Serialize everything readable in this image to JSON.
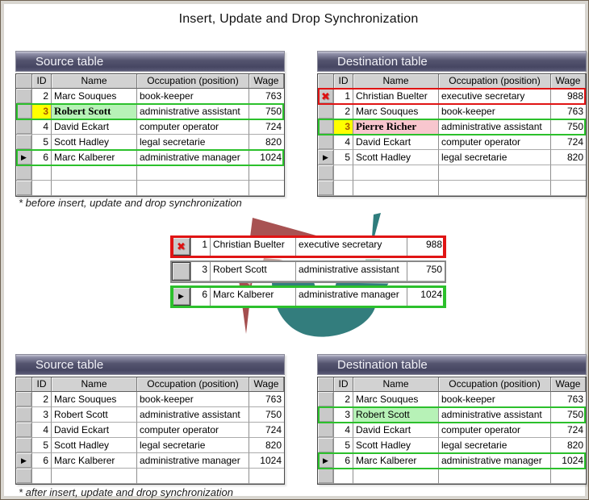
{
  "page": {
    "title": "Insert, Update and Drop Synchronization",
    "caption_before": "* before insert, update and drop synchronization",
    "caption_after": "* after insert, update and drop synchronization"
  },
  "columns": {
    "id": "ID",
    "name": "Name",
    "occupation": "Occupation (position)",
    "wage": "Wage"
  },
  "icons": {
    "arrow": "▶",
    "delete": "✖"
  },
  "colors": {
    "green-border": "#2cc02c",
    "red-border": "#e01414",
    "yellow-cell": "#ffff00",
    "yellow-text": "#a85400",
    "green-cell": "#b7f2b7",
    "pink-cell": "#f8c6ce",
    "delete-x": "#dd1111",
    "titlebar-dark": "#464662",
    "logo-teal": "#337d7d",
    "logo-teal-light": "#92c0b8",
    "logo-red": "#a85252"
  },
  "tables": [
    {
      "id": "source-before",
      "title": "Source table",
      "empty_rows": 2,
      "rows": [
        {
          "id": "2",
          "name": "Marc Souques",
          "occupation": "book-keeper",
          "wage": "763"
        },
        {
          "id": "3",
          "name": "Robert Scott",
          "occupation": "administrative assistant",
          "wage": "750",
          "highlight": "green",
          "id_bg": "yellow",
          "name_bg": "green",
          "bold_name": true
        },
        {
          "id": "4",
          "name": "David Eckart",
          "occupation": "computer operator",
          "wage": "724"
        },
        {
          "id": "5",
          "name": "Scott Hadley",
          "occupation": "legal secretarie",
          "wage": "820"
        },
        {
          "id": "6",
          "name": "Marc Kalberer",
          "occupation": "administrative manager",
          "wage": "1024",
          "highlight": "green",
          "selector": "arrow"
        }
      ]
    },
    {
      "id": "destination-before",
      "title": "Destination table",
      "empty_rows": 2,
      "rows": [
        {
          "id": "1",
          "name": "Christian Buelter",
          "occupation": "executive secretary",
          "wage": "988",
          "highlight": "red",
          "selector": "delete"
        },
        {
          "id": "2",
          "name": "Marc Souques",
          "occupation": "book-keeper",
          "wage": "763"
        },
        {
          "id": "3",
          "name": "Pierre Richer",
          "occupation": "administrative assistant",
          "wage": "750",
          "highlight": "green",
          "id_bg": "yellow",
          "name_bg": "pink",
          "bold_name": true
        },
        {
          "id": "4",
          "name": "David Eckart",
          "occupation": "computer operator",
          "wage": "724"
        },
        {
          "id": "5",
          "name": "Scott Hadley",
          "occupation": "legal secretarie",
          "wage": "820",
          "selector": "arrow"
        }
      ]
    },
    {
      "id": "source-after",
      "title": "Source table",
      "empty_rows": 1,
      "rows": [
        {
          "id": "2",
          "name": "Marc Souques",
          "occupation": "book-keeper",
          "wage": "763"
        },
        {
          "id": "3",
          "name": "Robert Scott",
          "occupation": "administrative assistant",
          "wage": "750"
        },
        {
          "id": "4",
          "name": "David Eckart",
          "occupation": "computer operator",
          "wage": "724"
        },
        {
          "id": "5",
          "name": "Scott Hadley",
          "occupation": "legal secretarie",
          "wage": "820"
        },
        {
          "id": "6",
          "name": "Marc Kalberer",
          "occupation": "administrative manager",
          "wage": "1024",
          "selector": "arrow"
        }
      ]
    },
    {
      "id": "destination-after",
      "title": "Destination table",
      "empty_rows": 1,
      "rows": [
        {
          "id": "2",
          "name": "Marc Souques",
          "occupation": "book-keeper",
          "wage": "763"
        },
        {
          "id": "3",
          "name": "Robert Scott",
          "occupation": "administrative assistant",
          "wage": "750",
          "highlight": "green",
          "name_bg": "green"
        },
        {
          "id": "4",
          "name": "David Eckart",
          "occupation": "computer operator",
          "wage": "724"
        },
        {
          "id": "5",
          "name": "Scott Hadley",
          "occupation": "legal secretarie",
          "wage": "820"
        },
        {
          "id": "6",
          "name": "Marc Kalberer",
          "occupation": "administrative manager",
          "wage": "1024",
          "highlight": "green",
          "selector": "arrow"
        }
      ]
    }
  ],
  "sync_rows": [
    {
      "id": "1",
      "name": "Christian Buelter",
      "occupation": "executive secretary",
      "wage": "988",
      "highlight": "red",
      "selector": "delete"
    },
    {
      "id": "3",
      "name": "Robert Scott",
      "occupation": "administrative assistant",
      "wage": "750"
    },
    {
      "id": "6",
      "name": "Marc Kalberer",
      "occupation": "administrative manager",
      "wage": "1024",
      "highlight": "green",
      "selector": "arrow"
    }
  ]
}
